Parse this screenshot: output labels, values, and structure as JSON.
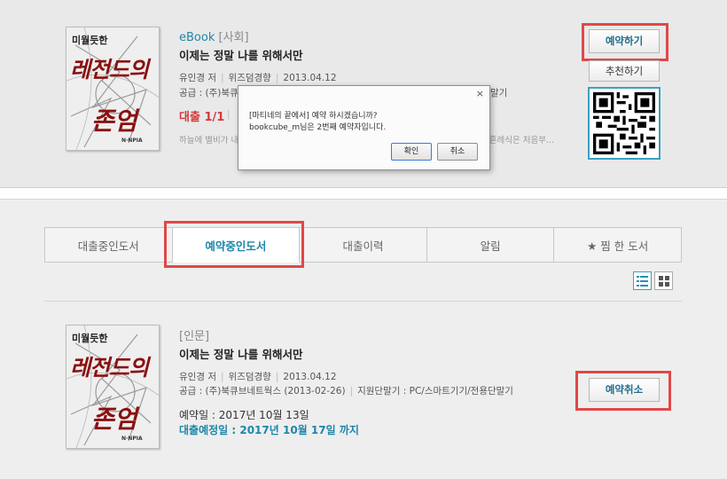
{
  "top_item": {
    "category_type": "eBook",
    "category_genre": "[사회]",
    "title": "이제는 정말 나를 위해서만",
    "author": "유인경 저",
    "publisher": "위즈덤경향",
    "date": "2013.04.12",
    "supply_line": "공급 : (주)북큐",
    "supply_tail": "말기",
    "loan_status": "대출 1/1",
    "desc_left": "하늘에 별비가 내",
    "desc_right": "의 혼례식은 처음부...",
    "btn_reserve": "예약하기",
    "btn_recommend": "추천하기"
  },
  "cover": {
    "publisher_mark": "미월듯한",
    "title_line1": "레전드의",
    "title_line2": "존엄",
    "logo": "N·NPIA"
  },
  "dialog": {
    "close": "×",
    "line1": "[마티네의 끝에서] 예약 하시겠습니까?",
    "line2": "bookcube_m님은 2번째 예약자입니다.",
    "ok": "확인",
    "cancel": "취소"
  },
  "tabs": [
    {
      "label": "대출중인도서"
    },
    {
      "label": "예약중인도서"
    },
    {
      "label": "대출이력"
    },
    {
      "label": "알림"
    },
    {
      "label": "★ 찜 한 도서"
    }
  ],
  "bottom_item": {
    "category_genre": "[인문]",
    "title": "이제는 정말 나를 위해서만",
    "author": "유인경 저",
    "publisher": "위즈덤경향",
    "date": "2013.04.12",
    "supply": "공급 : (주)북큐브네트웍스 (2013-02-26)",
    "device": "지원단말기 : PC/스마트기기/전용단말기",
    "reserve_date": "예약일 : 2017년 10월 13일",
    "due_date": "대출예정일 : 2017년 10월 17일 까지",
    "btn_cancel": "예약취소"
  },
  "colors": {
    "accent": "#1e87a8",
    "highlight": "#e04848",
    "loan_red": "#d23a3a"
  },
  "icons": {
    "list_view": "list-view-icon",
    "grid_view": "grid-view-icon"
  }
}
